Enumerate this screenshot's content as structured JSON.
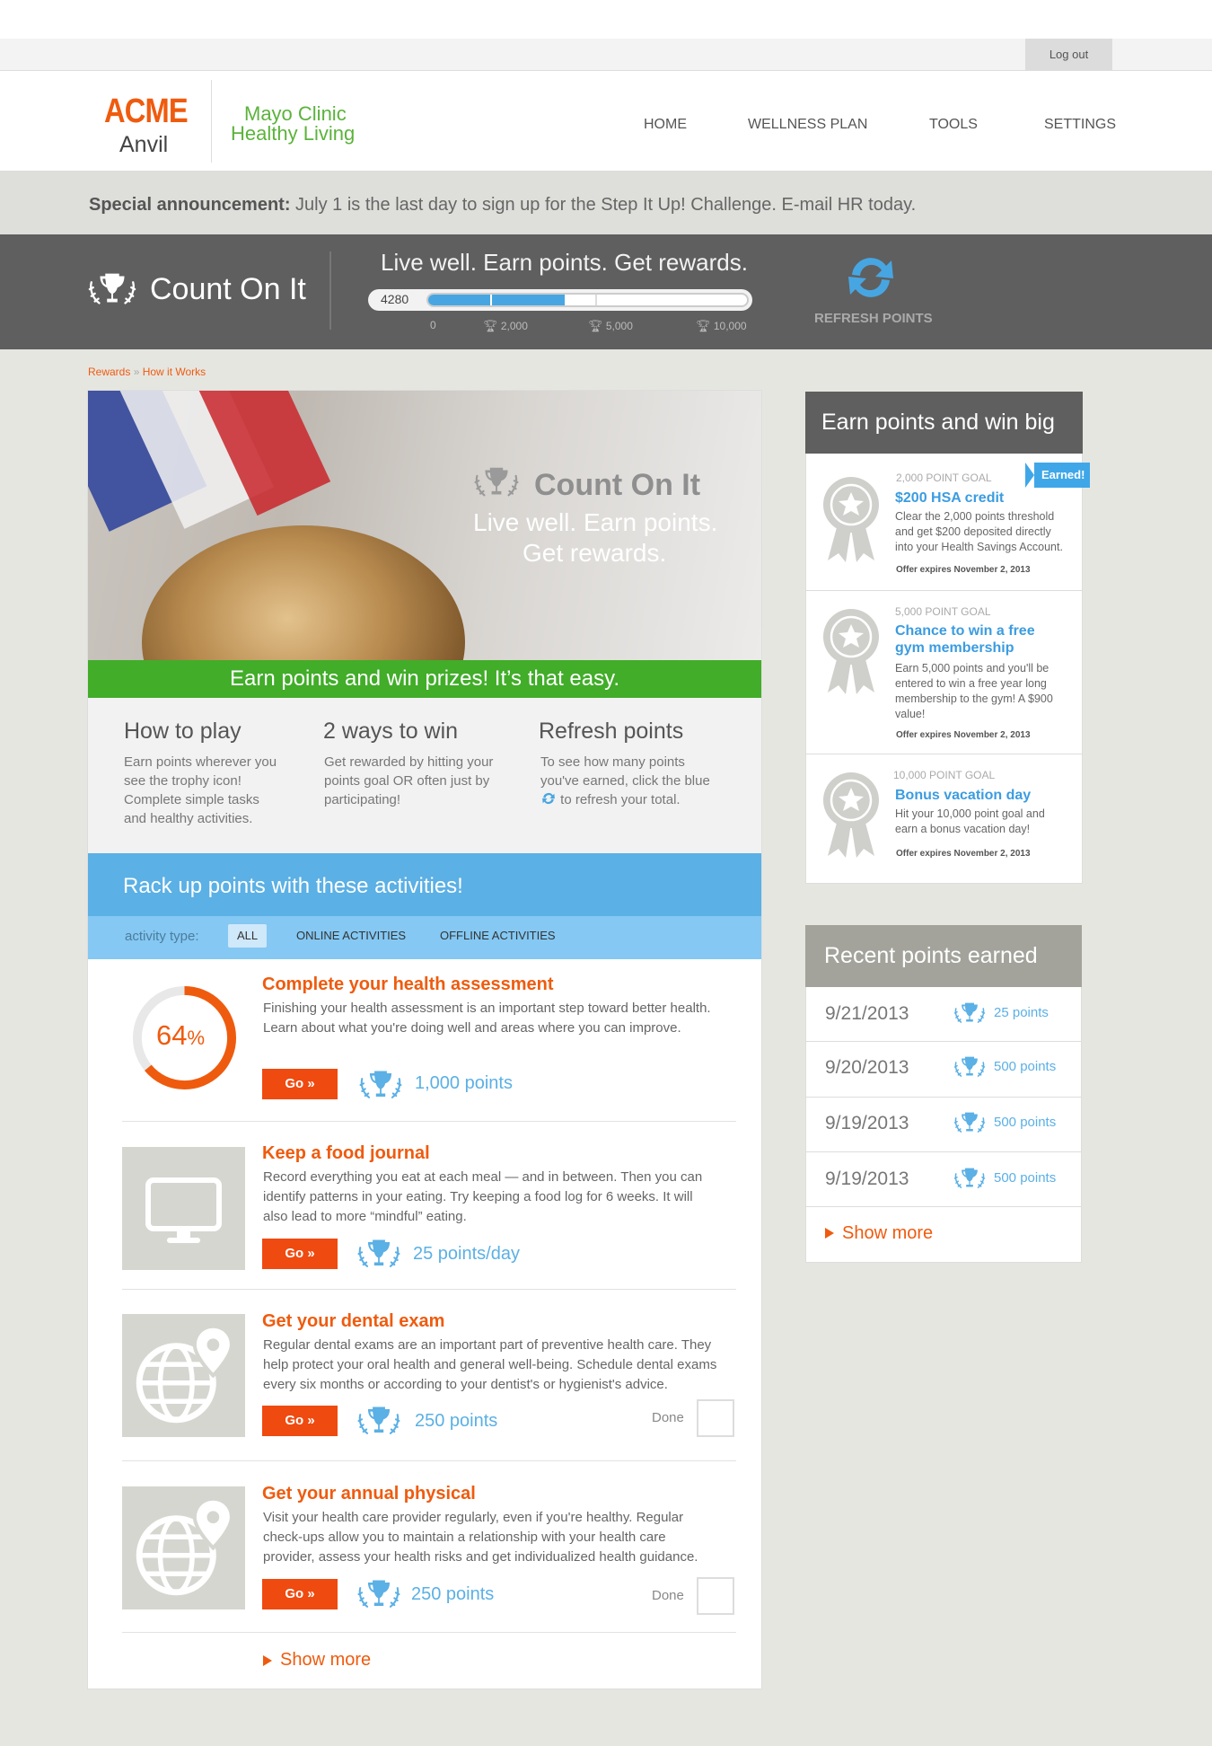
{
  "top": {
    "logout": "Log out"
  },
  "header": {
    "logo_main": "ACME",
    "logo_sub": "Anvil",
    "brand_line1": "Mayo Clinic",
    "brand_line2": "Healthy Living",
    "nav": [
      "HOME",
      "WELLNESS PLAN",
      "TOOLS",
      "SETTINGS"
    ]
  },
  "announcement": {
    "label": "Special announcement:",
    "text": " July 1 is the last day to sign up for the Step It Up! Challenge. E-mail HR today."
  },
  "points_band": {
    "title": "Count On It",
    "tagline": "Live well. Earn points. Get rewards.",
    "points": "4280",
    "progress_value": 4280,
    "progress_max": 10000,
    "ticks": [
      "0",
      "2,000",
      "5,000",
      "10,000"
    ],
    "refresh_label": "REFRESH POINTS"
  },
  "breadcrumb": {
    "item1": "Rewards",
    "sep": " » ",
    "item2": "How it Works"
  },
  "hero": {
    "title": "Count On It",
    "line1": "Live well. Earn points.",
    "line2": "Get rewards.",
    "banner": "Earn points and win prizes! It’s that easy."
  },
  "how": [
    {
      "heading": "How to play",
      "text": [
        "Earn points wherever you",
        "see the trophy icon!",
        "Complete simple tasks",
        "and healthy activities."
      ]
    },
    {
      "heading": "2 ways to win",
      "text": [
        "Get rewarded by hitting your",
        "points goal OR often just by",
        "participating!"
      ]
    },
    {
      "heading": "Refresh points",
      "text": [
        "To see how many points",
        "you've earned, click the blue",
        "to refresh your total."
      ]
    }
  ],
  "activities_header": "Rack up points with these activities!",
  "filter": {
    "label": "activity type:",
    "options": [
      "ALL",
      "ONLINE ACTIVITIES",
      "OFFLINE ACTIVITIES"
    ],
    "selected": "ALL"
  },
  "activities": [
    {
      "title": "Complete your health assessment",
      "desc": [
        "Finishing your health assessment is an important step toward better health.",
        "Learn about what you're doing well and areas where you can improve."
      ],
      "go": "Go »",
      "points": "1,000 points",
      "progress": "64",
      "progress_unit": "%",
      "progress_value": 0.64
    },
    {
      "title": "Keep a food journal",
      "desc": [
        "Record everything you eat at each meal — and in between. Then you can",
        "identify patterns in your eating. Try keeping a food log for 6 weeks. It will",
        "also lead to more “mindful” eating."
      ],
      "go": "Go »",
      "points": "25 points/day",
      "icon": "monitor-icon"
    },
    {
      "title": "Get your dental exam",
      "desc": [
        "Regular dental exams are an important part of preventive health care.  They",
        "help protect your oral health and general well-being. Schedule dental exams",
        "every six months or according to your dentist's or hygienist's advice."
      ],
      "go": "Go »",
      "points": "250 points",
      "done": "Done",
      "icon": "globe-pin-icon"
    },
    {
      "title": "Get your annual physical",
      "desc": [
        "Visit your health care provider regularly, even if you're healthy. Regular",
        "check-ups allow you to maintain a relationship with your health care",
        "provider, assess your health risks and get individualized health guidance."
      ],
      "go": "Go »",
      "points": "250 points",
      "done": "Done",
      "icon": "globe-pin-icon"
    }
  ],
  "activities_show_more": "Show more",
  "earn_box": {
    "title": "Earn points and win big",
    "badge": "Earned!",
    "goals": [
      {
        "label": "2,000 POINT GOAL",
        "title": [
          "$200 HSA credit"
        ],
        "desc": [
          "Clear the 2,000 points threshold",
          "and get $200 deposited directly",
          "into your Health Savings Account."
        ],
        "expires": "Offer expires November 2, 2013"
      },
      {
        "label": "5,000 POINT GOAL",
        "title": [
          "Chance to win a free",
          "gym membership"
        ],
        "desc": [
          "Earn 5,000 points and you'll be",
          "entered to win a free year long",
          "membership to the gym! A $900",
          "value!"
        ],
        "expires": "Offer expires November 2, 2013"
      },
      {
        "label": "10,000 POINT GOAL",
        "title": [
          "Bonus vacation day"
        ],
        "desc": [
          "Hit your 10,000 point goal and",
          "earn a bonus vacation day!"
        ],
        "expires": "Offer expires November 2, 2013"
      }
    ]
  },
  "recent": {
    "title": "Recent points earned",
    "rows": [
      {
        "date": "9/21/2013",
        "points": "25 points"
      },
      {
        "date": "9/20/2013",
        "points": "500 points"
      },
      {
        "date": "9/19/2013",
        "points": "500 points"
      },
      {
        "date": "9/19/2013",
        "points": "500 points"
      }
    ],
    "show_more": "Show more"
  },
  "colors": {
    "accent_orange": "#ef5b0e",
    "accent_blue": "#5bb0e5",
    "accent_green": "#41ad29",
    "band_gray": "#5f5f5f"
  }
}
